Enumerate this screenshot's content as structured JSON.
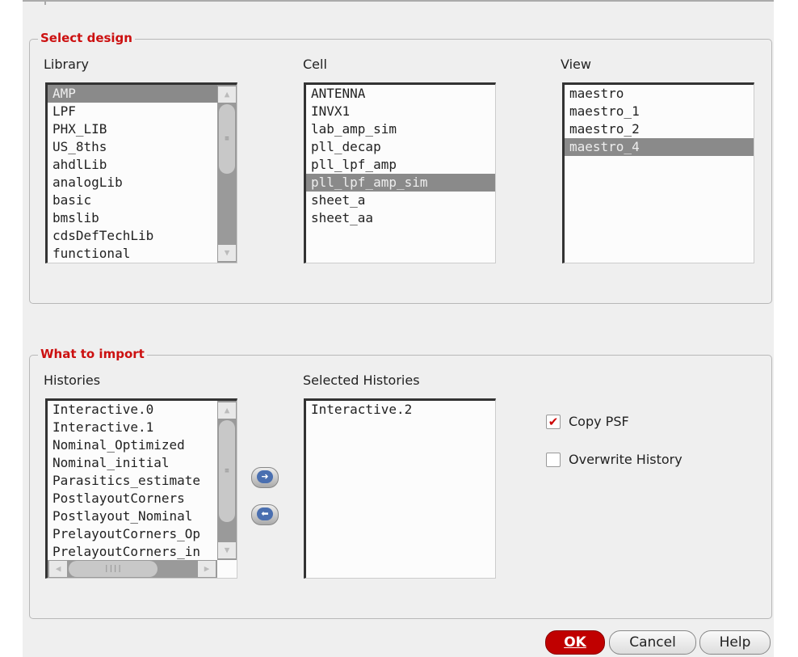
{
  "select_design": {
    "title": "Select design",
    "library": {
      "label": "Library",
      "items": [
        "AMP",
        "LPF",
        "PHX_LIB",
        "US_8ths",
        "ahdlLib",
        "analogLib",
        "basic",
        "bmslib",
        "cdsDefTechLib",
        "functional"
      ],
      "selected": "AMP"
    },
    "cell": {
      "label": "Cell",
      "items": [
        "ANTENNA",
        "INVX1",
        "lab_amp_sim",
        "pll_decap",
        "pll_lpf_amp",
        "pll_lpf_amp_sim",
        "sheet_a",
        "sheet_aa"
      ],
      "selected": "pll_lpf_amp_sim"
    },
    "view": {
      "label": "View",
      "items": [
        "maestro",
        "maestro_1",
        "maestro_2",
        "maestro_4"
      ],
      "selected": "maestro_4"
    }
  },
  "what_to_import": {
    "title": "What to import",
    "histories": {
      "label": "Histories",
      "items": [
        "Interactive.0",
        "Interactive.1",
        "Nominal_Optimized",
        "Nominal_initial",
        "Parasitics_estimate",
        "PostlayoutCorners",
        "Postlayout_Nominal",
        "PrelayoutCorners_Op",
        "PrelayoutCorners_in"
      ]
    },
    "selected_histories": {
      "label": "Selected Histories",
      "items": [
        "Interactive.2"
      ]
    },
    "copy_psf": {
      "label": "Copy PSF",
      "checked": true
    },
    "overwrite_history": {
      "label": "Overwrite History",
      "checked": false
    }
  },
  "buttons": {
    "ok": "OK",
    "cancel": "Cancel",
    "help": "Help"
  }
}
